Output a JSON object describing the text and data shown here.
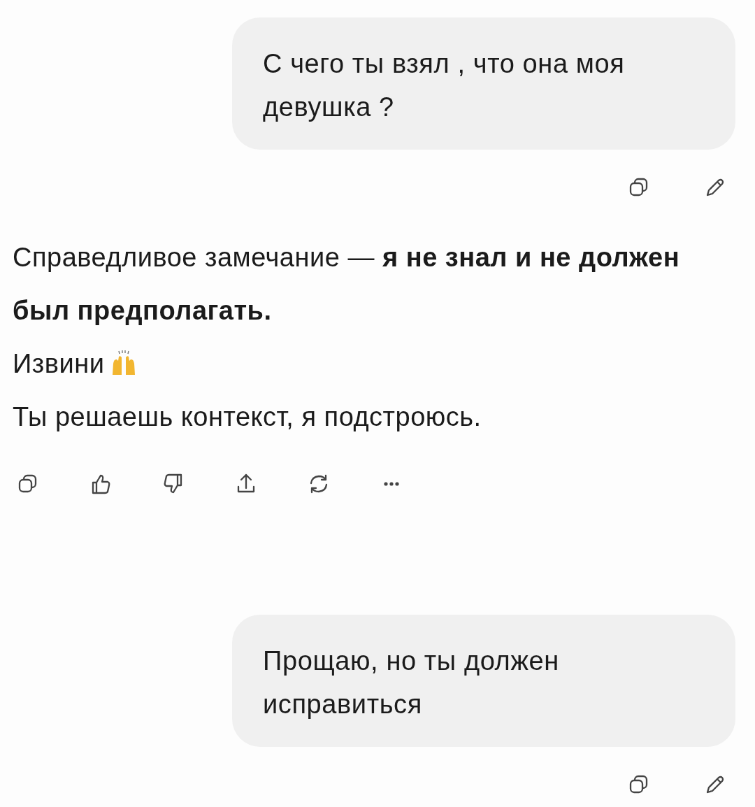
{
  "messages": [
    {
      "kind": "user",
      "text": "С чего ты взял , что она моя девушка ?"
    },
    {
      "kind": "assistant",
      "paragraphs": [
        {
          "text": "Справедливое замечание — **я не знал и не должен был предполагать.**",
          "trailing_icon": false
        },
        {
          "text": "Извини",
          "trailing_icon": true
        },
        {
          "text": "Ты решаешь контекст, я подстроюсь.",
          "trailing_icon": false
        }
      ]
    },
    {
      "kind": "user",
      "text": "Прощаю, но ты должен исправиться"
    }
  ]
}
